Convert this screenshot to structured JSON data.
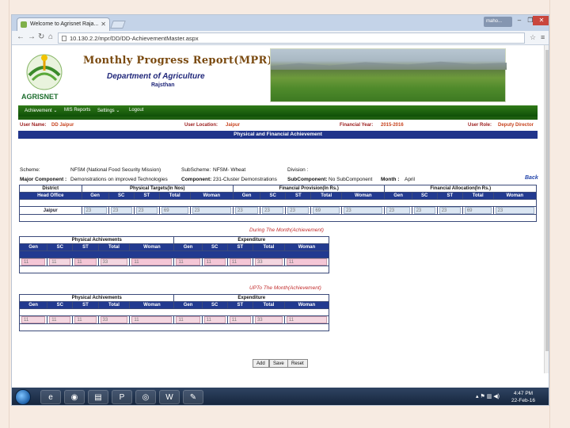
{
  "browser": {
    "tab_title": "Welcome to Agrisnet Raja...",
    "url": "10.130.2.2/mpr/DD/DD-AchievementMaster.aspx",
    "user_chip": "maho...",
    "min_label": "–",
    "max_label": "❐",
    "close_label": "✕"
  },
  "banner": {
    "title": "Monthly Progress Report(MPR)",
    "dept": "Department of Agriculture",
    "state": "Rajsthan",
    "logo_text": "AGRISNET"
  },
  "menu": {
    "items": [
      "Achievement ⌄",
      "MIS Reports",
      "Settings ⌄",
      "Logout"
    ]
  },
  "info": {
    "user_name_label": "User Name:",
    "user_name": "DD Jaipur",
    "location_label": "User Location:",
    "location": "Jaipur",
    "fy_label": "Financial Year:",
    "fy": "2015-2016",
    "role_label": "User Role:",
    "role": "Deputy Director"
  },
  "section_title": "Physical and Financial Achievement",
  "scheme": {
    "scheme_label": "Scheme:",
    "scheme": "NFSM (National Food Security Mission)",
    "subscheme_label": "SubScheme:",
    "subscheme": "NFSM- Wheat",
    "division_label": "Division :",
    "division": "",
    "major_label": "Major Component :",
    "major": "Demonstrations on improved Technologies",
    "component_label": "Component:",
    "component": "231-Cluster Demonstrations",
    "subcomp_label": "SubComponent:",
    "subcomp": "No SubComponent",
    "month_label": "Month :",
    "month": "April",
    "back": "Back"
  },
  "main_table": {
    "group_headers": [
      "District",
      "Physical Targets(In Nos)",
      "Financial Provision(In Rs.)",
      "Financial Allocation(In Rs.)"
    ],
    "columns": [
      "Head Office",
      "Gen",
      "SC",
      "ST",
      "Total",
      "Woman",
      "Gen",
      "SC",
      "ST",
      "Total",
      "Woman",
      "Gen",
      "SC",
      "ST",
      "Total",
      "Woman"
    ],
    "district": "Jaipur",
    "values": [
      "23",
      "23",
      "23",
      "69",
      "23",
      "23",
      "23",
      "23",
      "69",
      "23",
      "23",
      "23",
      "23",
      "69",
      "23"
    ]
  },
  "during_caption": "During The Month(Achievement)",
  "upto_caption": "UPTo The Month(Achievement)",
  "achieve1": {
    "group_headers": [
      "Physical Achivements",
      "Expenditure"
    ],
    "columns": [
      "Gen",
      "SC",
      "ST",
      "Total",
      "Woman",
      "Gen",
      "SC",
      "ST",
      "Total",
      "Woman"
    ],
    "values": [
      "11",
      "11",
      "11",
      "33",
      "11",
      "11",
      "11",
      "11",
      "33",
      "11"
    ]
  },
  "achieve2": {
    "group_headers": [
      "Physical Achivements",
      "Expenditure"
    ],
    "columns": [
      "Gen",
      "SC",
      "ST",
      "Total",
      "Woman",
      "Gen",
      "SC",
      "ST",
      "Total",
      "Woman"
    ],
    "values": [
      "11",
      "11",
      "11",
      "33",
      "11",
      "11",
      "11",
      "11",
      "33",
      "11"
    ]
  },
  "buttons": {
    "add": "Add",
    "save": "Save",
    "reset": "Reset"
  },
  "taskbar": {
    "icons": [
      "ie-icon",
      "firefox-icon",
      "explorer-icon",
      "powerpoint-icon",
      "chrome-icon",
      "word-icon",
      "paint-icon"
    ],
    "clock_time": "4:47 PM",
    "clock_date": "22-Feb-16"
  }
}
